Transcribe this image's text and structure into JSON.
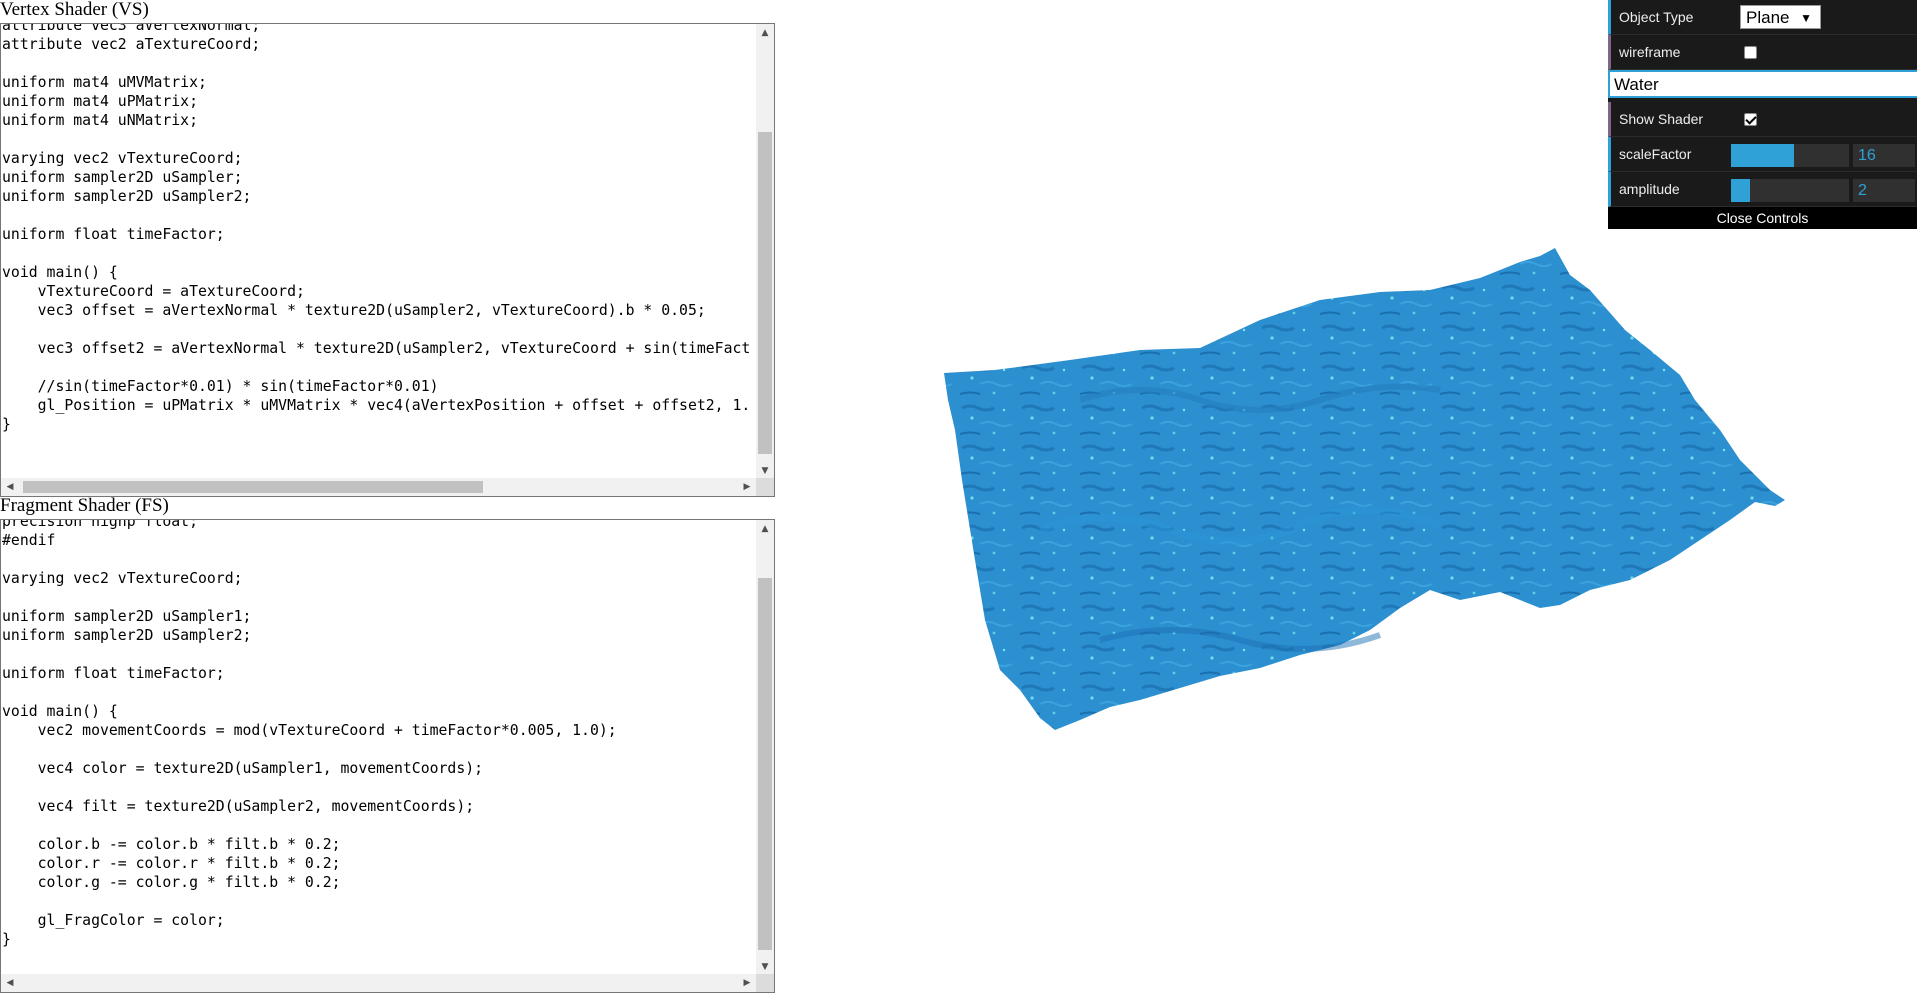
{
  "vertex_shader": {
    "label": "Vertex Shader (VS)",
    "code": "attribute vec3 aVertexNormal;\nattribute vec2 aTextureCoord;\n\nuniform mat4 uMVMatrix;\nuniform mat4 uPMatrix;\nuniform mat4 uNMatrix;\n\nvarying vec2 vTextureCoord;\nuniform sampler2D uSampler;\nuniform sampler2D uSampler2;\n\nuniform float timeFactor;\n\nvoid main() {\n    vTextureCoord = aTextureCoord;\n    vec3 offset = aVertexNormal * texture2D(uSampler2, vTextureCoord).b * 0.05;\n\n    vec3 offset2 = aVertexNormal * texture2D(uSampler2, vTextureCoord + sin(timeFact\n\n    //sin(timeFactor*0.01) * sin(timeFactor*0.01)\n    gl_Position = uPMatrix * uMVMatrix * vec4(aVertexPosition + offset + offset2, 1.\n}"
  },
  "fragment_shader": {
    "label": "Fragment Shader (FS)",
    "code": "precision highp float;\n#endif\n\nvarying vec2 vTextureCoord;\n\nuniform sampler2D uSampler1;\nuniform sampler2D uSampler2;\n\nuniform float timeFactor;\n\nvoid main() {\n    vec2 movementCoords = mod(vTextureCoord + timeFactor*0.005, 1.0);\n\n    vec4 color = texture2D(uSampler1, movementCoords);\n\n    vec4 filt = texture2D(uSampler2, movementCoords);\n\n    color.b -= color.b * filt.b * 0.2;\n    color.r -= color.r * filt.b * 0.2;\n    color.g -= color.g * filt.b * 0.2;\n\n    gl_FragColor = color;\n}"
  },
  "gui": {
    "object_type_label": "Object Type",
    "object_type_value": "Plane",
    "wireframe_label": "wireframe",
    "wireframe_checked": false,
    "folder_title": "Water",
    "show_shader_label": "Show Shader",
    "show_shader_checked": true,
    "scale_factor_label": "scaleFactor",
    "scale_factor_value": "16",
    "scale_factor_fill": 0.53,
    "amplitude_label": "amplitude",
    "amplitude_value": "2",
    "amplitude_fill": 0.16,
    "close_label": "Close Controls",
    "accent_color": "#2fa1d6"
  },
  "scene": {
    "water_color": "#2b8fd0",
    "highlight_color": "#6fdde8"
  }
}
